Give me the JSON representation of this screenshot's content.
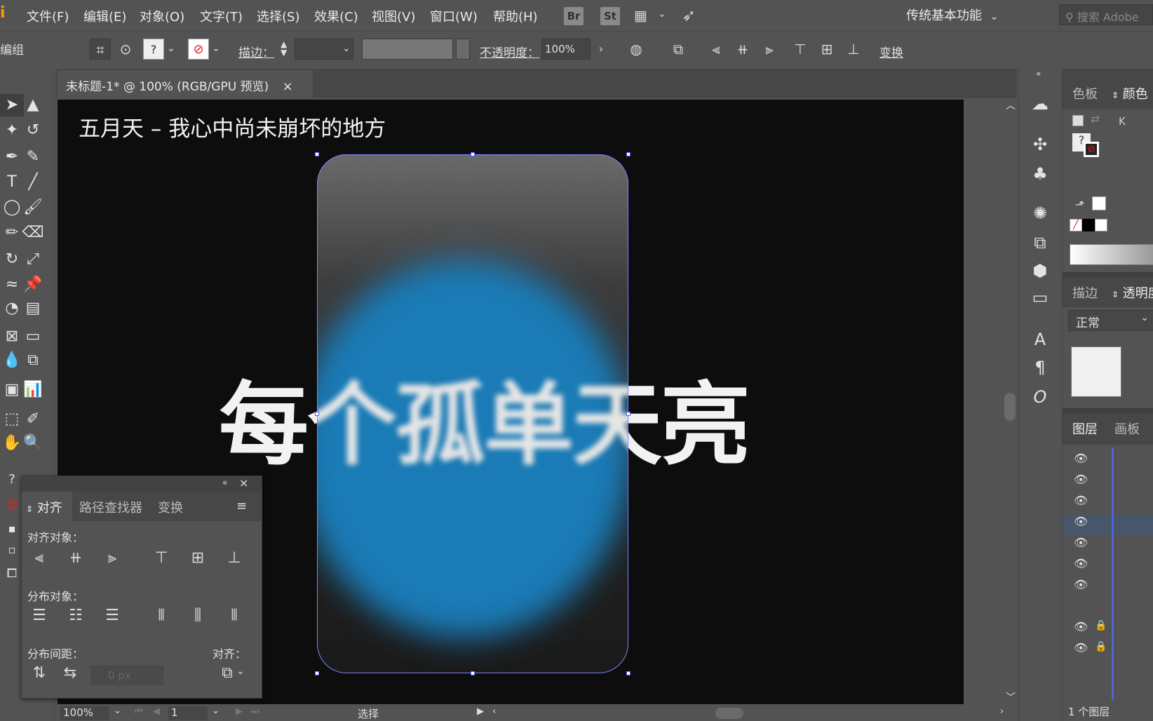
{
  "menubar": {
    "app_letter": "i",
    "items": [
      "文件(F)",
      "编辑(E)",
      "对象(O)",
      "文字(T)",
      "选择(S)",
      "效果(C)",
      "视图(V)",
      "窗口(W)",
      "帮助(H)"
    ],
    "bridge_badge": "Br",
    "stock_badge": "St",
    "workspace": "传统基本功能",
    "search_placeholder": "搜索 Adobe"
  },
  "controlbar": {
    "selection_type": "编组",
    "stroke_label": "描边：",
    "opacity_label": "不透明度：",
    "opacity_value": "100%",
    "transform_label": "变换"
  },
  "document": {
    "tab_title": "未标题-1* @ 100% (RGB/GPU 预览)",
    "close_glyph": "×"
  },
  "canvas": {
    "title_text": "五月天 – 我心中尚未崩坏的地方",
    "lyric_text": "每个孤单天亮",
    "blob_color": "#1a7bb6",
    "selection_color": "#7a86ff"
  },
  "statusbar": {
    "zoom": "100%",
    "artboard_number": "1",
    "tool_name": "选择"
  },
  "align_panel": {
    "tabs": [
      "对齐",
      "路径查找器",
      "变换"
    ],
    "align_objects_label": "对齐对象：",
    "distribute_objects_label": "分布对象：",
    "distribute_spacing_label": "分布间距：",
    "align_to_label": "对齐：",
    "spacing_value": "0 px"
  },
  "right_panels": {
    "swatches_tab": "色板",
    "color_tab": "颜色",
    "k_label": "K",
    "stroke_tab": "描边",
    "transparency_tab": "透明度",
    "blend_mode": "正常",
    "layers_tab": "图层",
    "artboards_tab": "画板",
    "layers_count": "1 个图层"
  }
}
